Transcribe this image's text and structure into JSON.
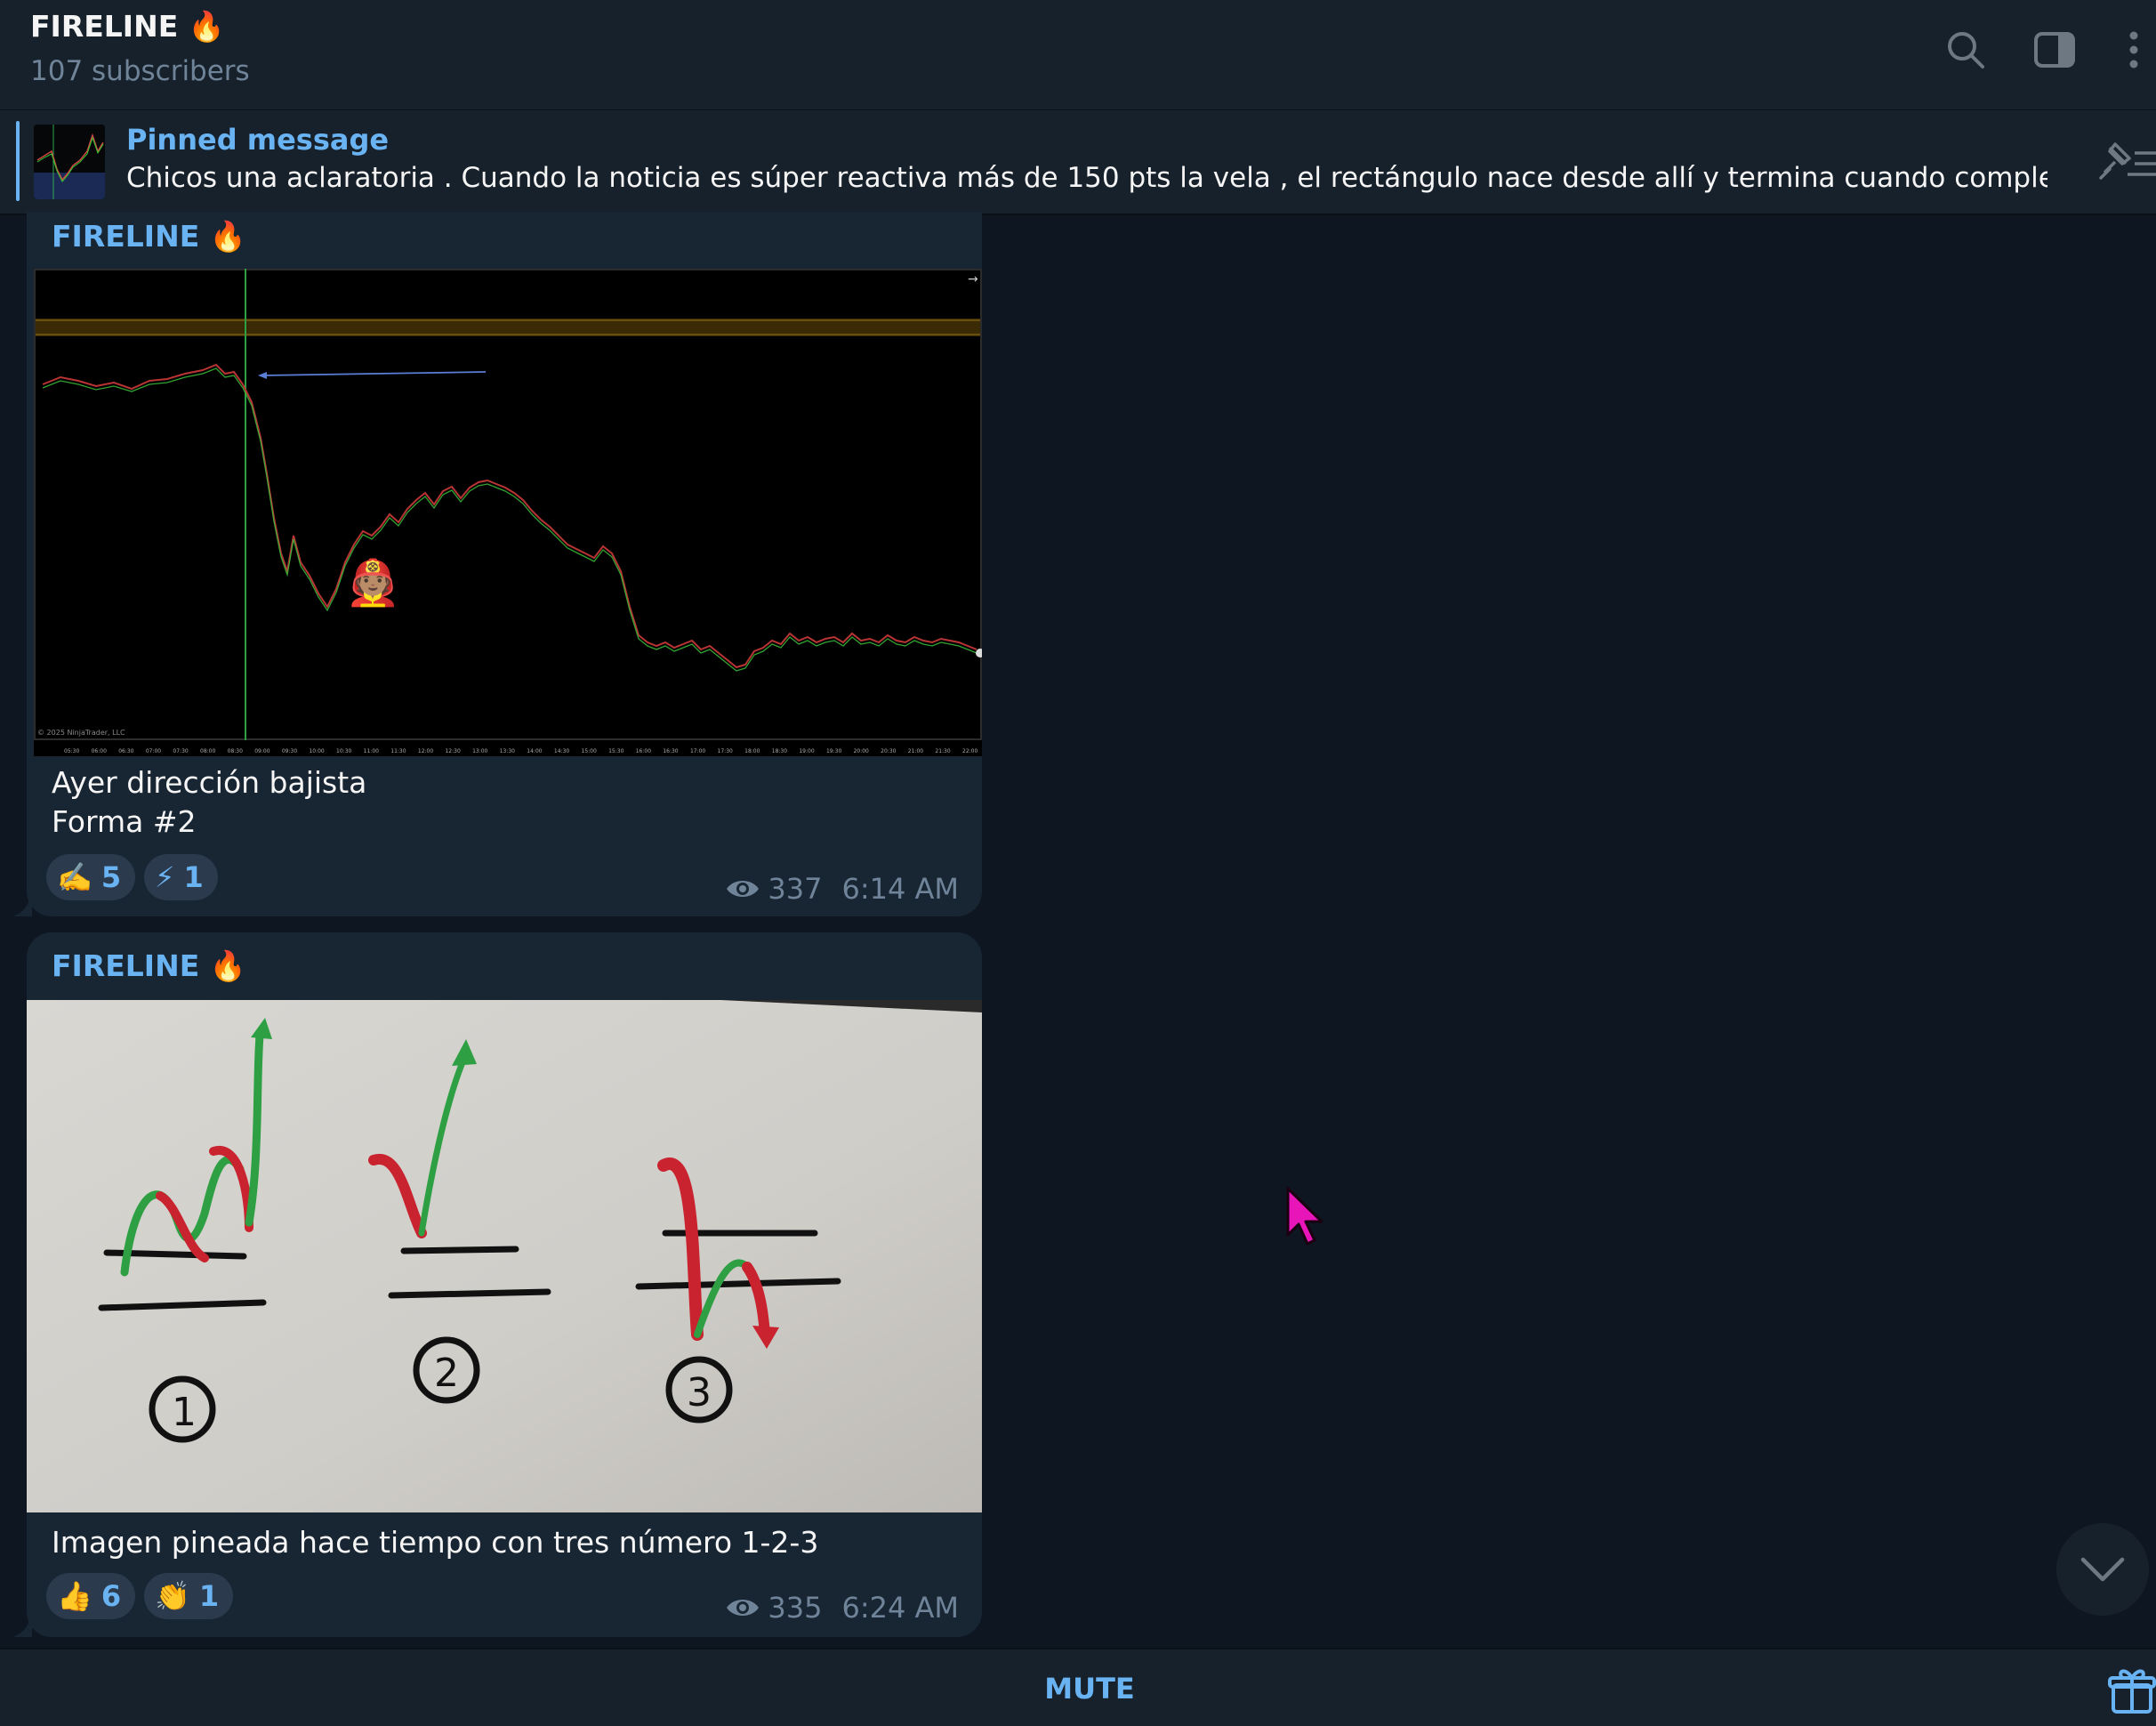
{
  "header": {
    "title": "FIRELINE 🔥",
    "subscribers": "107 subscribers",
    "icons": [
      "search-icon",
      "sidebar-toggle-icon",
      "more-vert-icon"
    ]
  },
  "pinned": {
    "label": "Pinned message",
    "text": "Chicos una aclaratoria .  Cuando la noticia es súper reactiva más de 150 pts la vela , el rectángulo nace desde allí y termina cuando complete las..."
  },
  "messages": [
    {
      "author": "FIRELINE 🔥",
      "caption_line1": "Ayer dirección bajista",
      "caption_line2": "Forma #2",
      "reactions": [
        {
          "emoji": "✍️",
          "count": "5"
        },
        {
          "emoji": "⚡",
          "count": "1"
        }
      ],
      "views": "337",
      "time": "6:14 AM",
      "image_watermark": "© 2025 NinjaTrader, LLC",
      "image_axis_times": [
        "05:30",
        "06:00",
        "06:30",
        "07:00",
        "07:30",
        "08:00",
        "08:30",
        "09:00",
        "09:30",
        "10:00",
        "10:30",
        "11:00",
        "11:30",
        "12:00",
        "12:30",
        "13:00",
        "13:30",
        "14:00",
        "14:30",
        "15:00",
        "15:30",
        "16:00",
        "16:30",
        "17:00",
        "17:30",
        "18:00",
        "18:30",
        "19:00",
        "19:30",
        "20:00",
        "20:30",
        "21:00",
        "21:30",
        "22:00"
      ]
    },
    {
      "author": "FIRELINE 🔥",
      "caption_line1": "Imagen pineada hace tiempo con tres número 1-2-3",
      "reactions": [
        {
          "emoji": "👍",
          "count": "6"
        },
        {
          "emoji": "👏",
          "count": "1"
        }
      ],
      "views": "335",
      "time": "6:24 AM",
      "drawing_numbers": [
        "1",
        "2",
        "3"
      ]
    }
  ],
  "bottom": {
    "mute_label": "MUTE"
  },
  "colors": {
    "background": "#0e1621",
    "panel": "#17212b",
    "bubble": "#182533",
    "accent": "#6ab3f3",
    "muted": "#708499",
    "cursor": "#e815b9"
  }
}
